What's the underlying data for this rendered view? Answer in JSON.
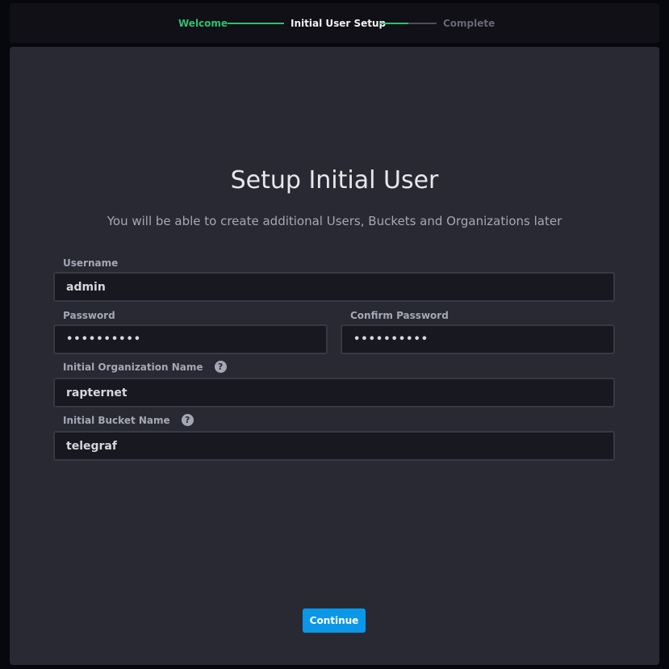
{
  "stepper": {
    "steps": [
      {
        "label": "Welcome",
        "state": "done"
      },
      {
        "label": "Initial User Setup",
        "state": "current"
      },
      {
        "label": "Complete",
        "state": "pending"
      }
    ],
    "colors": {
      "done": "#2fbf6f",
      "current": "#f1f1f3",
      "pending": "#676775"
    }
  },
  "form": {
    "title": "Setup Initial User",
    "subtitle": "You will be able to create additional Users, Buckets and Organizations later",
    "username": {
      "label": "Username",
      "value": "admin"
    },
    "password": {
      "label": "Password",
      "value": "••••••••••"
    },
    "confirm_password": {
      "label": "Confirm Password",
      "value": "••••••••••"
    },
    "organization": {
      "label": "Initial Organization Name",
      "value": "rapternet",
      "help_icon": "question-circle-icon"
    },
    "bucket": {
      "label": "Initial Bucket Name",
      "value": "telegraf",
      "help_icon": "question-circle-icon"
    },
    "continue_label": "Continue",
    "accent_color": "#0b97e8"
  }
}
